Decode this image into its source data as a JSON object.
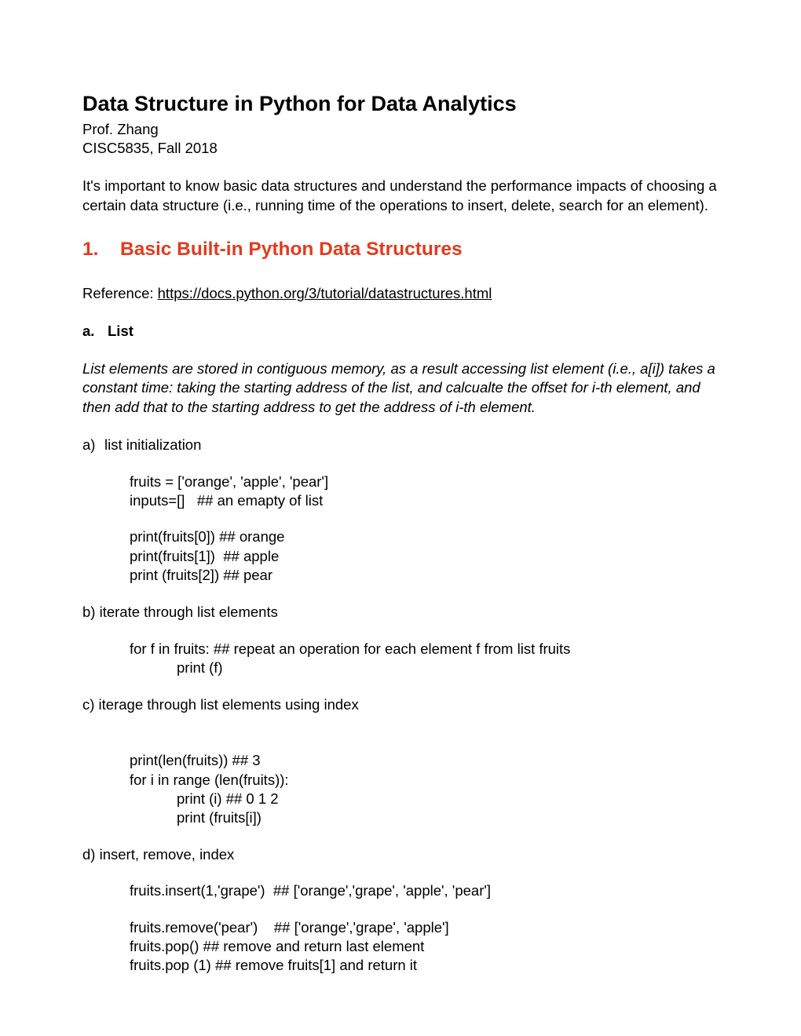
{
  "title": "Data Structure in Python for Data Analytics",
  "author": "Prof. Zhang",
  "course": "CISC5835, Fall 2018",
  "intro": "It's important to know basic data structures and understand the performance impacts of choosing a certain data structure (i.e., running time of the operations to insert, delete, search for an element).",
  "section": {
    "number": "1.",
    "title": "Basic Built-in Python Data Structures"
  },
  "reference_label": "Reference: ",
  "reference_url": "https://docs.python.org/3/tutorial/datastructures.html",
  "subsection": {
    "letter": "a.",
    "title": "List"
  },
  "list_description": "List elements are stored in contiguous memory, as a result accessing list element (i.e., a[i]) takes a constant time: taking the starting address of the list, and calcualte the offset for i-th element, and then add that to the starting address to get the address of i-th element.",
  "items": {
    "a": {
      "letter": "a)",
      "label": "list initialization",
      "code1": "fruits = ['orange', 'apple', 'pear']\ninputs=[]   ## an emapty of list",
      "code2": "print(fruits[0]) ## orange\nprint(fruits[1])  ## apple\nprint (fruits[2]) ## pear"
    },
    "b": {
      "label": "b) iterate through list elements",
      "code_line1": "for f in fruits:  ## repeat an operation for each element f from list fruits",
      "code_line2": "print (f)"
    },
    "c": {
      "label": "c) iterage through list elements using index",
      "code_line1": "print(len(fruits))  ## 3",
      "code_line2": "for i in range (len(fruits)):",
      "code_line3": "print (i)   ## 0 1 2",
      "code_line4": "print (fruits[i])"
    },
    "d": {
      "label": "d) insert, remove, index",
      "code1": "fruits.insert(1,'grape')  ## ['orange','grape', 'apple', 'pear']",
      "code2": "fruits.remove('pear')    ## ['orange','grape', 'apple']\nfruits.pop() ## remove and return last element\nfruits.pop (1) ## remove fruits[1] and return it"
    }
  }
}
